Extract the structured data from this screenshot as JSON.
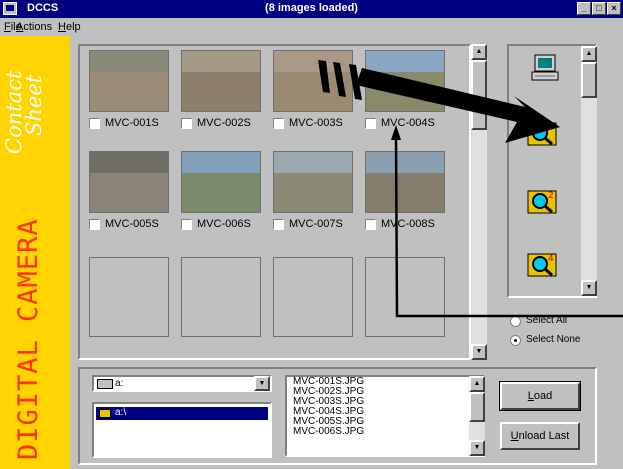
{
  "window": {
    "app_name": "DCCS",
    "title": "(8 images loaded)",
    "controls": {
      "minimize": "_",
      "maximize": "□",
      "close": "×"
    }
  },
  "menu": [
    {
      "label": "File",
      "accel": "F",
      "rest": "ile"
    },
    {
      "label": "Actions",
      "accel": "A",
      "rest": "ctions"
    },
    {
      "label": "Help",
      "accel": "H",
      "rest": "elp"
    }
  ],
  "branding": {
    "contact_sheet": "Contact Sheet",
    "contact_line1": "Contact",
    "contact_line2": "Sheet",
    "digital_camera": "DIGITAL CAMERA"
  },
  "thumbnails": [
    {
      "label": "MVC-001S",
      "checked": false,
      "sky": "#8a8a7a",
      "ground": "#9b8c78"
    },
    {
      "label": "MVC-002S",
      "checked": false,
      "sky": "#a59a88",
      "ground": "#8d7f6a"
    },
    {
      "label": "MVC-003S",
      "checked": false,
      "sky": "#a89a86",
      "ground": "#9a8a72"
    },
    {
      "label": "MVC-004S",
      "checked": false,
      "sky": "#8aa6c2",
      "ground": "#8a8a6a"
    },
    {
      "label": "MVC-005S",
      "checked": false,
      "sky": "#6e6e66",
      "ground": "#8a8378"
    },
    {
      "label": "MVC-006S",
      "checked": false,
      "sky": "#7fa0b8",
      "ground": "#7a8a6a"
    },
    {
      "label": "MVC-007S",
      "checked": false,
      "sky": "#9aa8b0",
      "ground": "#8a8a76"
    },
    {
      "label": "MVC-008S",
      "checked": false,
      "sky": "#8aa0b0",
      "ground": "#857d6c"
    }
  ],
  "empty_slots": 4,
  "right_panel": {
    "icons": [
      "computer-icon",
      "zoom-folder-icon",
      "zoom-folder-2-icon",
      "zoom-folder-4-icon"
    ],
    "zoom_badges": [
      "",
      "2",
      "4"
    ]
  },
  "selection": {
    "select_all": "Select All",
    "select_none": "Select None",
    "selected": "select_none"
  },
  "drive": {
    "value": "a:"
  },
  "directories": [
    {
      "label": "a:\\",
      "selected": true
    }
  ],
  "files": [
    "MVC-001S.JPG",
    "MVC-002S.JPG",
    "MVC-003S.JPG",
    "MVC-004S.JPG",
    "MVC-005S.JPG",
    "MVC-006S.JPG"
  ],
  "buttons": {
    "load": "Load",
    "load_accel": "L",
    "load_rest": "oad",
    "unload": "Unload Last",
    "unload_accel": "U",
    "unload_rest": "nload Last"
  },
  "colors": {
    "title_bar": "#000080",
    "face": "#c0c0c0",
    "sidebar": "#ffd400",
    "sidebar_text": "#ff3300",
    "selection": "#000080",
    "annotation_arrow": "#000000"
  }
}
